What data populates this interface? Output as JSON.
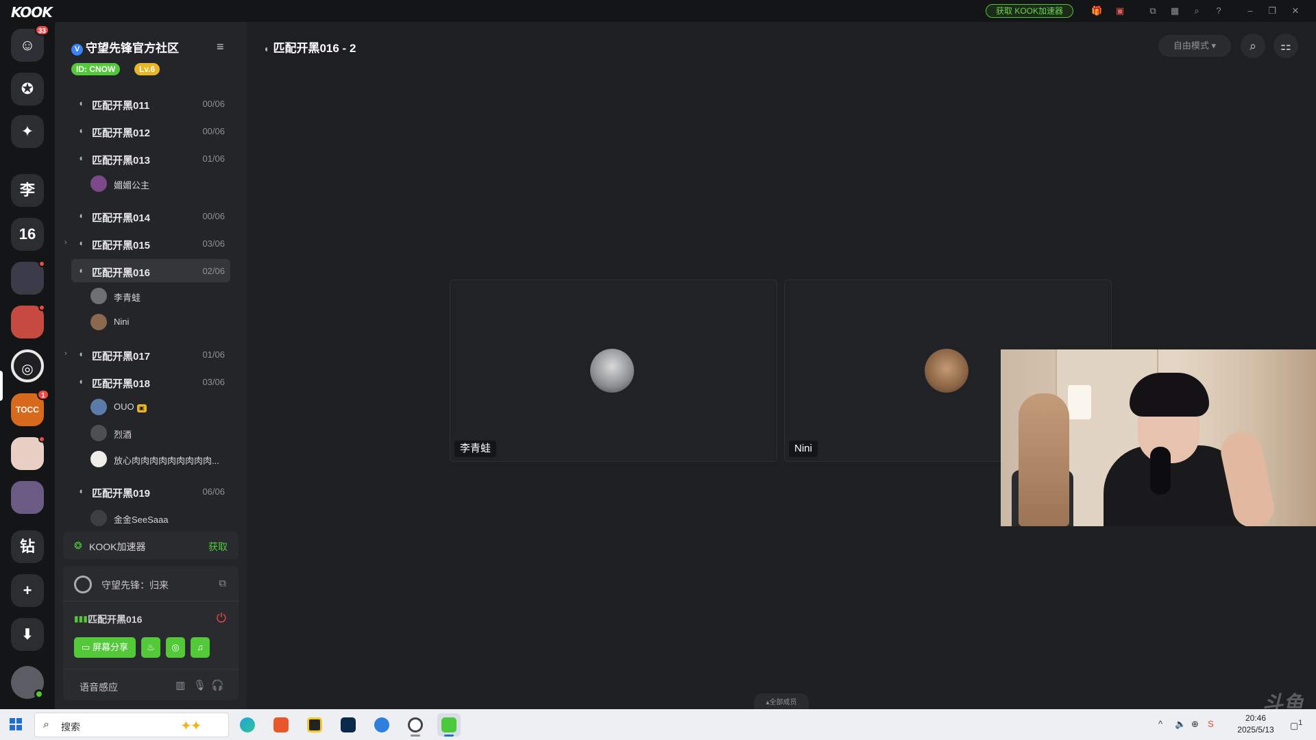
{
  "titlebar": {
    "logo": "KOOK",
    "accelerator_button": "获取 KOOK加速器",
    "icons": [
      "gift-icon",
      "shop-icon",
      "screenshot-icon",
      "window-icon",
      "search-icon",
      "help-icon",
      "minimize-icon",
      "restore-icon",
      "close-icon"
    ]
  },
  "guildbar": {
    "dm_badge": "33",
    "items": [
      {
        "label": "李"
      },
      {
        "label": "16"
      },
      {
        "label": "钻"
      }
    ],
    "tocc_badge": "1",
    "tocc_label": "TOCC"
  },
  "server": {
    "name": "守望先锋官方社区",
    "id_badge": "ID: CNOW",
    "level_badge": "Lv.6"
  },
  "channels": [
    {
      "name": "匹配开黑011",
      "count": "00/06",
      "members": []
    },
    {
      "name": "匹配开黑012",
      "count": "00/06",
      "members": []
    },
    {
      "name": "匹配开黑013",
      "count": "01/06",
      "members": [
        {
          "name": "媚媚公主"
        }
      ]
    },
    {
      "name": "匹配开黑014",
      "count": "00/06",
      "members": []
    },
    {
      "name": "匹配开黑015",
      "count": "03/06",
      "members": []
    },
    {
      "name": "匹配开黑016",
      "count": "02/06",
      "members": [
        {
          "name": "李青蛙"
        },
        {
          "name": "Nini"
        }
      ]
    },
    {
      "name": "匹配开黑017",
      "count": "01/06",
      "members": []
    },
    {
      "name": "匹配开黑018",
      "count": "03/06",
      "members": [
        {
          "name": "OUO"
        },
        {
          "name": "烈酒"
        },
        {
          "name": "放心肉肉肉肉肉肉肉肉肉..."
        }
      ]
    },
    {
      "name": "匹配开黑019",
      "count": "06/06",
      "members": [
        {
          "name": "金金SeeSaaa"
        }
      ]
    }
  ],
  "accelerator": {
    "label": "KOOK加速器",
    "action": "获取"
  },
  "voice_panel": {
    "game": "守望先锋：归来",
    "channel": "匹配开黑016",
    "buttons": {
      "screen_share": "屏幕分享"
    },
    "voice_mode": "语音感应"
  },
  "main": {
    "title": "匹配开黑016 - 2",
    "mode": "自由模式",
    "tiles": [
      {
        "name": "李青蛙"
      },
      {
        "name": "Nini"
      }
    ],
    "all_members": "全部成员",
    "watermark": "斗鱼"
  },
  "taskbar": {
    "search_placeholder": "搜索",
    "time": "20:46",
    "date": "2025/5/13",
    "notification_count": "1"
  },
  "colors": {
    "accent_green": "#53c93a",
    "level_yellow": "#e8b624",
    "badge_red": "#f04a47",
    "verified_blue": "#3b82f6"
  }
}
